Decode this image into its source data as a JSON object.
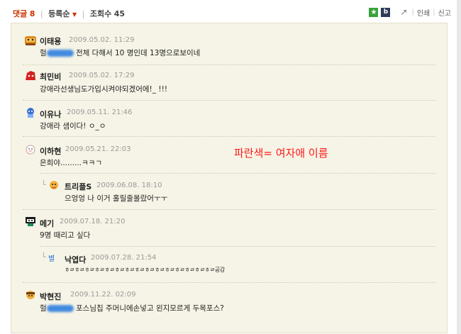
{
  "toolbar": {
    "comments_label": "댓글",
    "comments_count": "8",
    "sort_label": "등록순",
    "views_label": "조회수",
    "views_count": "45",
    "print_label": "인쇄",
    "report_label": "신고"
  },
  "overlay_note": "파란색= 여자애 이름",
  "comments": [
    {
      "nick": "이태용",
      "date": "2009.05.02. 11:29",
      "text_before": "헐",
      "text_after": "전체 다해서 10 명인데 13명으로보이네"
    },
    {
      "nick": "최민비",
      "date": "2009.05.02. 17:29",
      "text": "강애라선생님도가입시켜야되겠어에!_ !!!"
    },
    {
      "nick": "이유나",
      "date": "2009.05.11. 21:46",
      "text": "강애라 샘이다! ㅇ_ㅇ"
    },
    {
      "nick": "이하현",
      "date": "2009.05.21. 22:03",
      "text": "은희야.........ㅋㅋㄱ"
    },
    {
      "nick": "트리플S",
      "date": "2009.06.08. 18:10",
      "text": "으엉엉 나 이거 홀릴줄몰랐어ㅜㅜ"
    },
    {
      "nick": "메기",
      "date": "2009.07.18. 21:20",
      "text": "9명 때리고 싶다"
    },
    {
      "nick": "낙엽다",
      "date": "2009.07.28. 21:54",
      "text": "ㅎㄹㅎㄹㅎㄹㅎㄹㅎㄹㅎㄹㅎㄹㅎㄹㅎㄹㅎㄹㅎㄹㅎㄹㅎㄹㅎㄹㅎㄹ공감"
    },
    {
      "nick": "박현진",
      "date": "2009.11.22. 02:09",
      "text_before": "헐",
      "text_after": "포스님칩 주머니에손넣고 왼지모르게 두목포스?"
    }
  ]
}
